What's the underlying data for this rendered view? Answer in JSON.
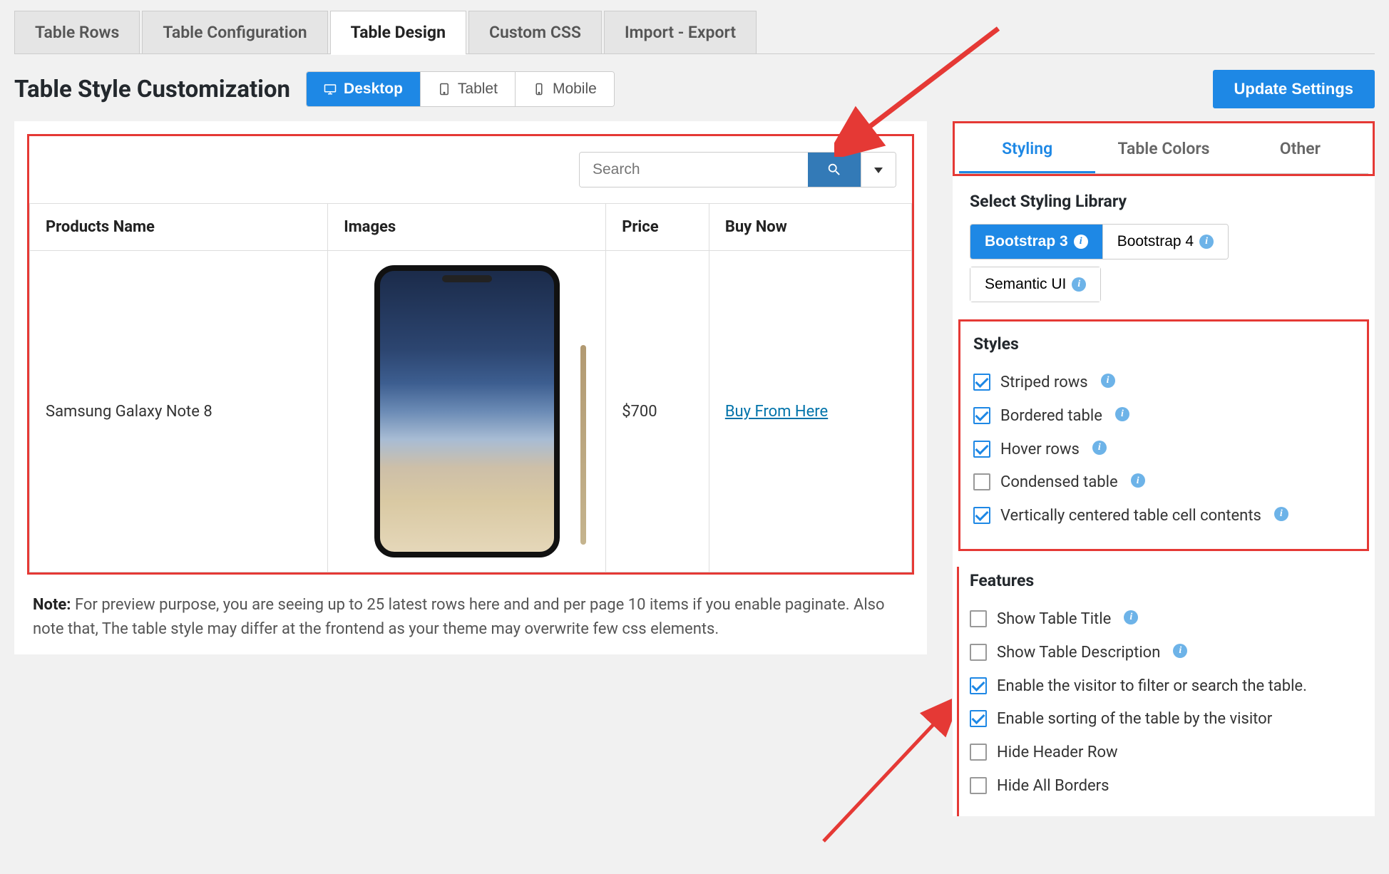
{
  "tabs": [
    "Table Rows",
    "Table Configuration",
    "Table Design",
    "Custom CSS",
    "Import - Export"
  ],
  "active_tab": 2,
  "page_title": "Table Style Customization",
  "devices": [
    "Desktop",
    "Tablet",
    "Mobile"
  ],
  "active_device": 0,
  "update_btn": "Update Settings",
  "search_placeholder": "Search",
  "table": {
    "headers": [
      "Products Name",
      "Images",
      "Price",
      "Buy Now"
    ],
    "rows": [
      {
        "name": "Samsung Galaxy Note 8",
        "price": "$700",
        "buy": "Buy From Here"
      }
    ]
  },
  "note_label": "Note:",
  "note_text": "For preview purpose, you are seeing up to 25 latest rows here and and per page 10 items if you enable paginate. Also note that, The table style may differ at the frontend as your theme may overwrite few css elements.",
  "side_tabs": [
    "Styling",
    "Table Colors",
    "Other"
  ],
  "active_side_tab": 0,
  "lib_title": "Select Styling Library",
  "libs": [
    "Bootstrap 3",
    "Bootstrap 4",
    "Semantic UI"
  ],
  "active_lib": 0,
  "styles_title": "Styles",
  "styles": [
    {
      "label": "Striped rows",
      "checked": true,
      "info": true
    },
    {
      "label": "Bordered table",
      "checked": true,
      "info": true
    },
    {
      "label": "Hover rows",
      "checked": true,
      "info": true
    },
    {
      "label": "Condensed table",
      "checked": false,
      "info": true
    },
    {
      "label": "Vertically centered table cell contents",
      "checked": true,
      "info": true
    }
  ],
  "features_title": "Features",
  "features": [
    {
      "label": "Show Table Title",
      "checked": false,
      "info": true
    },
    {
      "label": "Show Table Description",
      "checked": false,
      "info": true
    },
    {
      "label": "Enable the visitor to filter or search the table.",
      "checked": true,
      "info": false
    },
    {
      "label": "Enable sorting of the table by the visitor",
      "checked": true,
      "info": false
    },
    {
      "label": "Hide Header Row",
      "checked": false,
      "info": false
    },
    {
      "label": "Hide All Borders",
      "checked": false,
      "info": false
    }
  ]
}
